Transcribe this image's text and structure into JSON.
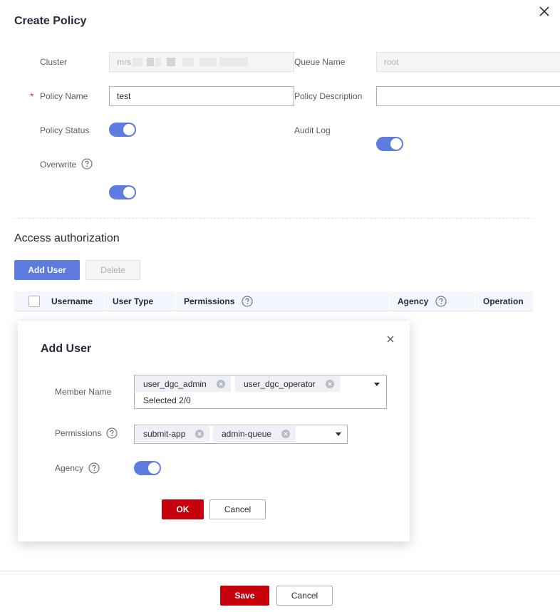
{
  "dialog": {
    "title": "Create Policy"
  },
  "form": {
    "cluster_label": "Cluster",
    "cluster_value": "mrs",
    "queue_name_label": "Queue Name",
    "queue_name_value": "root",
    "required_mark": "*",
    "policy_name_label": "Policy Name",
    "policy_name_value": "test",
    "policy_description_label": "Policy Description",
    "policy_description_value": "",
    "policy_status_label": "Policy Status",
    "policy_status_on": true,
    "audit_log_label": "Audit Log",
    "audit_log_on": true,
    "overwrite_label": "Overwrite",
    "overwrite_on": true
  },
  "access": {
    "title": "Access authorization",
    "add_user_label": "Add User",
    "delete_label": "Delete",
    "columns": [
      "Username",
      "User Type",
      "Permissions",
      "Agency",
      "Operation"
    ]
  },
  "modal": {
    "title": "Add User",
    "member_name_label": "Member Name",
    "member_tags": [
      "user_dgc_admin",
      "user_dgc_operator"
    ],
    "member_selected_text": "Selected 2/0",
    "permissions_label": "Permissions",
    "permission_tags": [
      "submit-app",
      "admin-queue"
    ],
    "agency_label": "Agency",
    "agency_on": true,
    "ok_label": "OK",
    "cancel_label": "Cancel"
  },
  "footer": {
    "save_label": "Save",
    "cancel_label": "Cancel"
  },
  "colors": {
    "primary": "#5e7ce0",
    "danger": "#c7000b",
    "required": "#e54545"
  }
}
